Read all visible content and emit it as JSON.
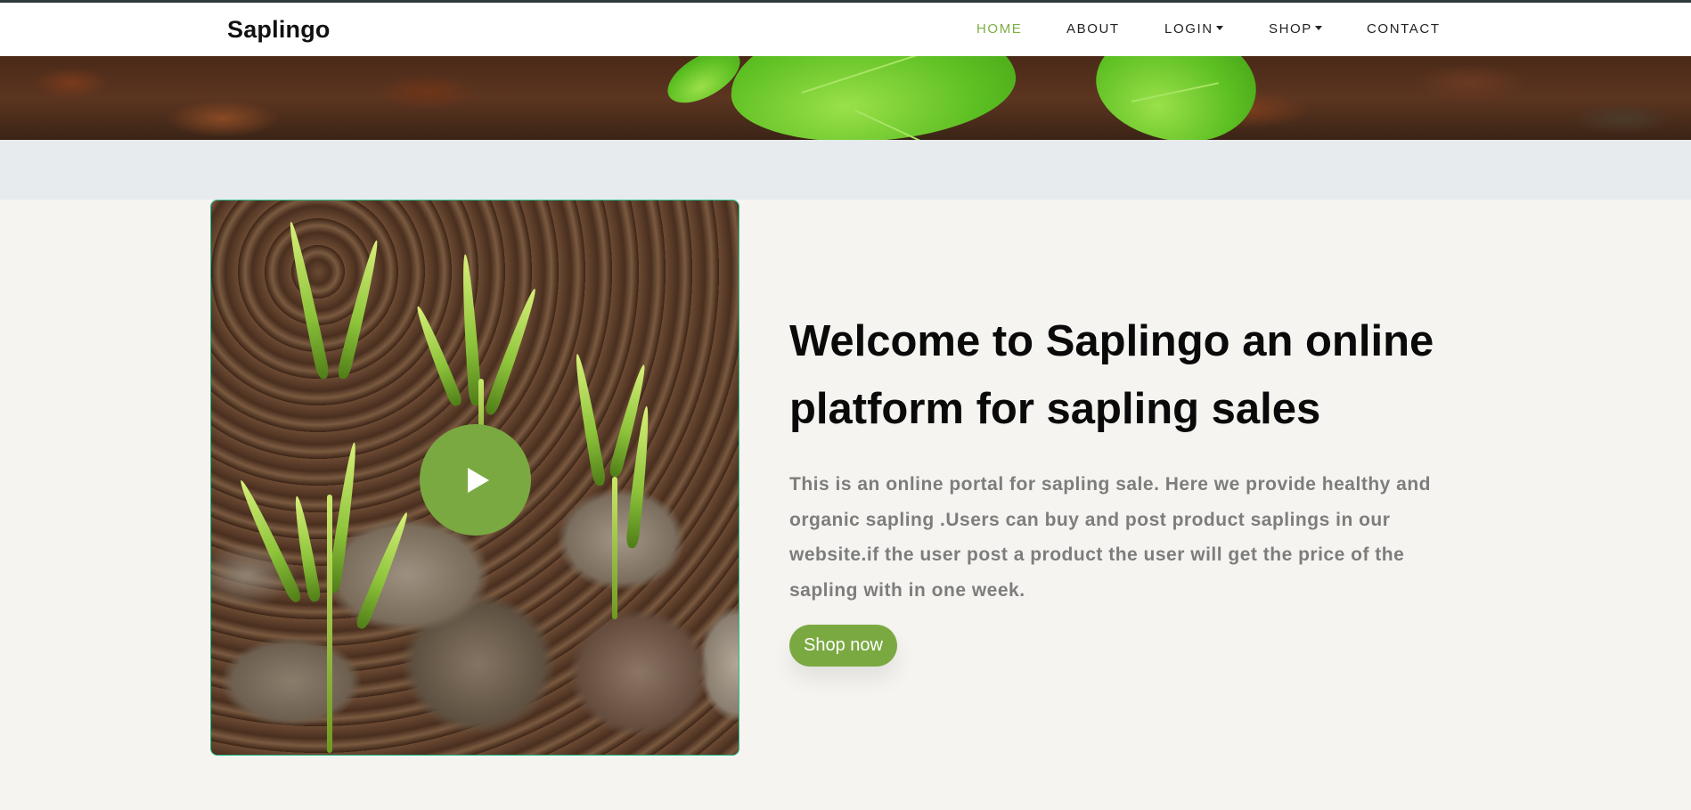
{
  "brand": {
    "name": "Saplingo"
  },
  "nav": {
    "items": [
      {
        "label": "HOME",
        "active": true,
        "dropdown": false
      },
      {
        "label": "ABOUT",
        "active": false,
        "dropdown": false
      },
      {
        "label": "LOGIN",
        "active": false,
        "dropdown": true
      },
      {
        "label": "SHOP",
        "active": false,
        "dropdown": true
      },
      {
        "label": "CONTACT",
        "active": false,
        "dropdown": false
      }
    ]
  },
  "hero": {
    "headline": "Welcome to Saplingo an online platform for sapling sales",
    "description": "This is an online portal for sapling sale. Here we provide healthy and organic sapling .Users can buy and post product saplings in our website.if the user post a product the user will get the price of the sapling with in one week.",
    "cta_label": "Shop now",
    "video_icon": "play-icon"
  },
  "colors": {
    "accent": "#7aa942",
    "nav_active": "#7cae42",
    "headline": "#0a0a0a",
    "body_text": "#7d7d7d",
    "page_bg": "#f5f4f0",
    "strip_bg": "#e7ebed"
  }
}
